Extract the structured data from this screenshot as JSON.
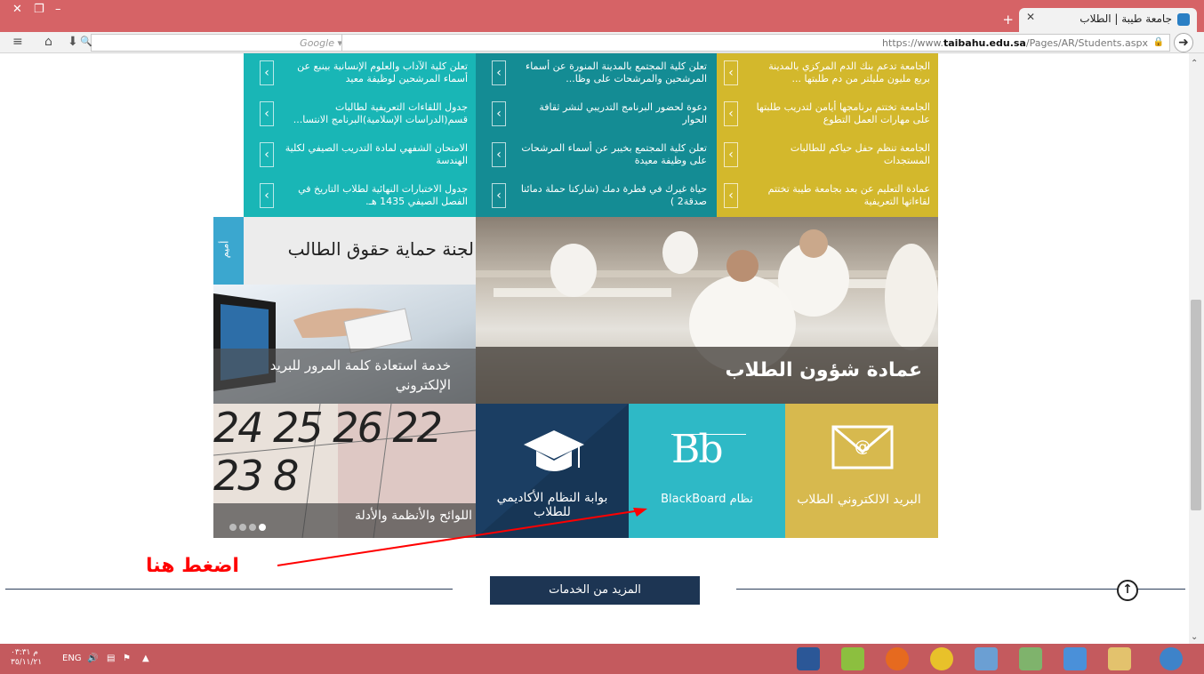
{
  "browser": {
    "tab_title": "جامعة طيبة | الطلاب",
    "search_placeholder": "Google",
    "url_prefix": "https://www.",
    "url_domain": "taibahu.edu.sa",
    "url_path": "/Pages/AR/Students.aspx"
  },
  "news": {
    "col_yellow": [
      "الجامعة تدعم بنك الدم المركزي بالمدينة بربع مليون مليلتر من دم طلبتها ...",
      "الجامعة تختتم برنامجها أيامن لتدريب طلبتها على مهارات العمل التطوع",
      "الجامعة تنظم حفل حياكم للطالبات المستجدات",
      "عمادة التعليم عن بعد بجامعة طيبة تختتم لقاءاتها التعريفية"
    ],
    "col_teal_dark": [
      "تعلن كلية المجتمع بالمدينة المنورة عن أسماء المرشحين والمرشحات على وظا...",
      "دعوة لحضور البرنامج التدريبي لنشر ثقافة الحوار",
      "تعلن كلية المجتمع بخيبر عن أسماء المرشحات على وظيفة معيدة",
      "حياة غيرك في قطرة دمك (شاركنا حملة دمائنا صدقة2 )"
    ],
    "col_teal": [
      "تعلن كلية الآداب والعلوم الإنسانية بينبع عن أسماء المرشحين لوظيفة معيد",
      "جدول اللقاءات التعريفية لطالبات قسم(الدراسات الإسلامية)البرنامج الانتسا...",
      "الامتحان الشفهي لمادة التدريب الصيفي لكلية الهندسة",
      "جدول الاختبارات النهائية لطلاب التاريخ في الفصل الصيفي 1435 هـ."
    ]
  },
  "tiles": {
    "rights": "لجنة حماية حقوق الطالب",
    "rights_side": "أميم",
    "deanship": "عمادة شؤون الطلاب",
    "password": "خدمة استعادة كلمة المرور للبريد الإلكتروني",
    "rules": "اللوائح والأنظمة والأدلة",
    "academic": "بوابة النظام الأكاديمي للطلاب",
    "blackboard": "نظام BlackBoard",
    "bb_logo": "Bb",
    "email": "البريد الالكتروني الطلاب",
    "more": "المزيد من الخدمات",
    "calendar_numbers": "24 25 26 22 23 8"
  },
  "annotation": {
    "click_here": "اضغط هنا",
    "color": "#ff0000"
  },
  "taskbar": {
    "lang": "ENG",
    "time": "م ٠٣:٣١",
    "date": "٣٥/١١/٢١"
  }
}
